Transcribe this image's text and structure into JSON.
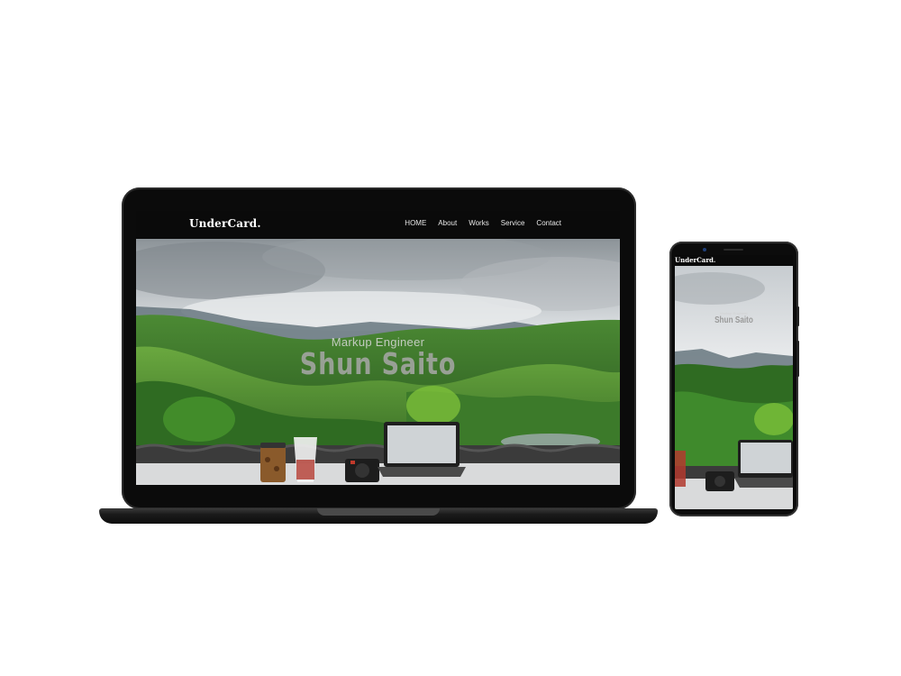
{
  "site": {
    "brand": "UnderCard.",
    "nav": [
      "HOME",
      "About",
      "Works",
      "Service",
      "Contact"
    ],
    "hero_subtitle": "Markup Engineer",
    "hero_title": "Shun Saito"
  },
  "colors": {
    "nav_bg": "#0a0a0a",
    "device_frame": "#0b0b0b",
    "hill_green": "#3f7a2c",
    "sky": "#dfe3e6"
  },
  "icons": {
    "laptop": "laptop-device-frame",
    "phone": "phone-device-frame"
  }
}
